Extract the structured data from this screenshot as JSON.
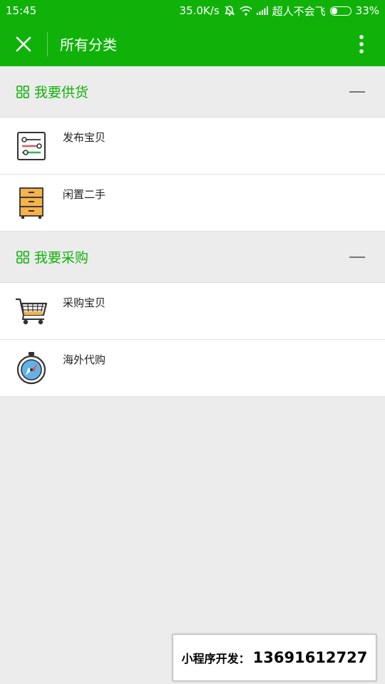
{
  "status_bar": {
    "time": "15:45",
    "speed": "35.0K/s",
    "carrier": "超人不会飞",
    "battery": "33%",
    "battery_level": 0.33
  },
  "app_bar": {
    "title": "所有分类",
    "close_icon": "close-icon",
    "more_icon": "more-vertical-icon"
  },
  "sections": [
    {
      "title": "我要供货",
      "items": [
        {
          "label": "发布宝贝",
          "icon": "sliders-icon"
        },
        {
          "label": "闲置二手",
          "icon": "cabinet-icon"
        }
      ]
    },
    {
      "title": "我要采购",
      "items": [
        {
          "label": "采购宝贝",
          "icon": "shopping-cart-icon"
        },
        {
          "label": "海外代购",
          "icon": "compass-icon"
        }
      ]
    }
  ],
  "watermark": {
    "label": "小程序开发：",
    "number": "13691612727"
  },
  "colors": {
    "brand": "#10b20a",
    "background": "#ececec"
  }
}
